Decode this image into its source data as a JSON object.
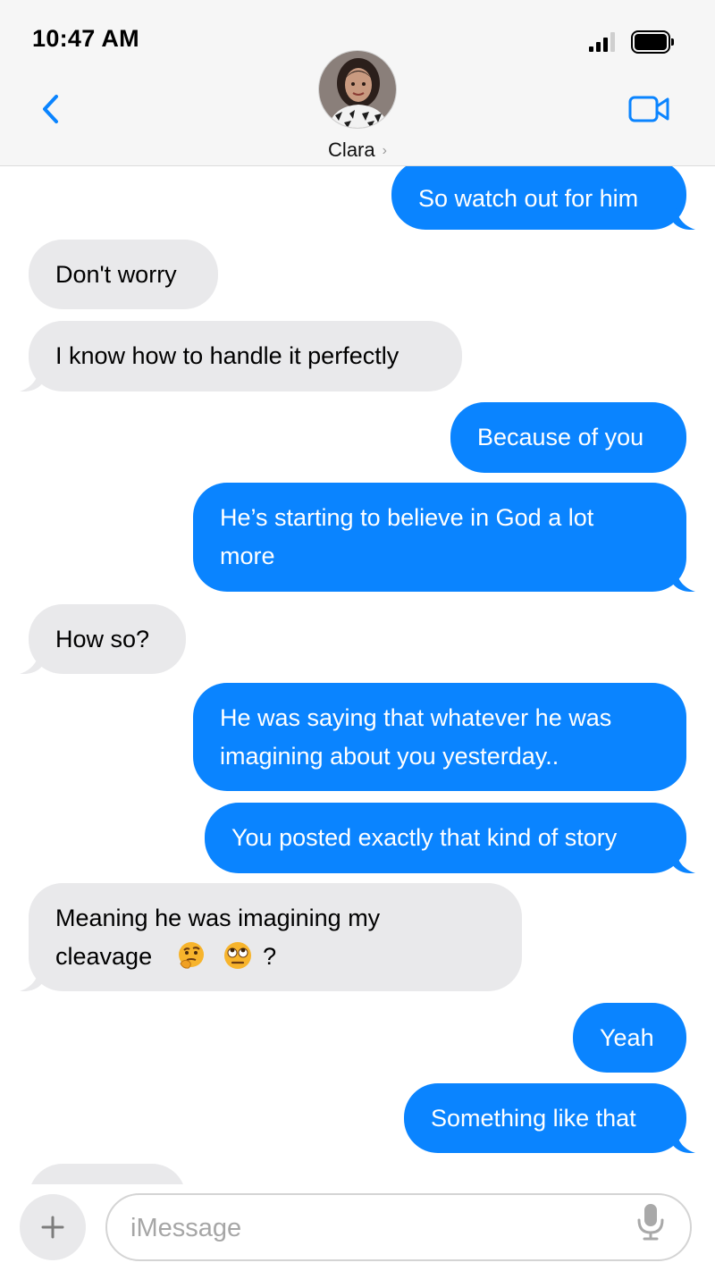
{
  "status_bar": {
    "time": "10:47 AM"
  },
  "header": {
    "contact_name": "Clara",
    "chevron": "›",
    "icons": {
      "back": "chevron-left-icon",
      "video": "video-camera-icon"
    }
  },
  "colors": {
    "accent": "#0a84ff",
    "sent_bubble": "#0a84ff",
    "received_bubble": "#e9e9eb",
    "header_bg": "#f6f6f6"
  },
  "messages": [
    {
      "side": "sent",
      "text": "So watch out for him"
    },
    {
      "side": "received",
      "text": "Don't worry"
    },
    {
      "side": "received",
      "text": "I know how to handle it perfectly"
    },
    {
      "side": "sent",
      "text": "Because of you"
    },
    {
      "side": "sent",
      "lines": [
        "He’s starting to believe in God a lot",
        "more"
      ]
    },
    {
      "side": "received",
      "text": "How so?"
    },
    {
      "side": "sent",
      "lines": [
        "He was saying that whatever he was",
        "imagining about you yesterday.."
      ]
    },
    {
      "side": "sent",
      "text": "You posted exactly that kind of story"
    },
    {
      "side": "received",
      "lines": [
        "Meaning he was imagining my",
        "cleavage"
      ],
      "emojis": [
        "thinking-face-emoji",
        "eye-roll-emoji"
      ],
      "suffix": "?"
    },
    {
      "side": "sent",
      "text": "Yeah"
    },
    {
      "side": "sent",
      "text": "Something like that"
    },
    {
      "side": "received",
      "text": ""
    }
  ],
  "composer": {
    "placeholder": "iMessage",
    "value": "",
    "icons": {
      "add": "plus-icon",
      "mic": "microphone-icon"
    }
  }
}
